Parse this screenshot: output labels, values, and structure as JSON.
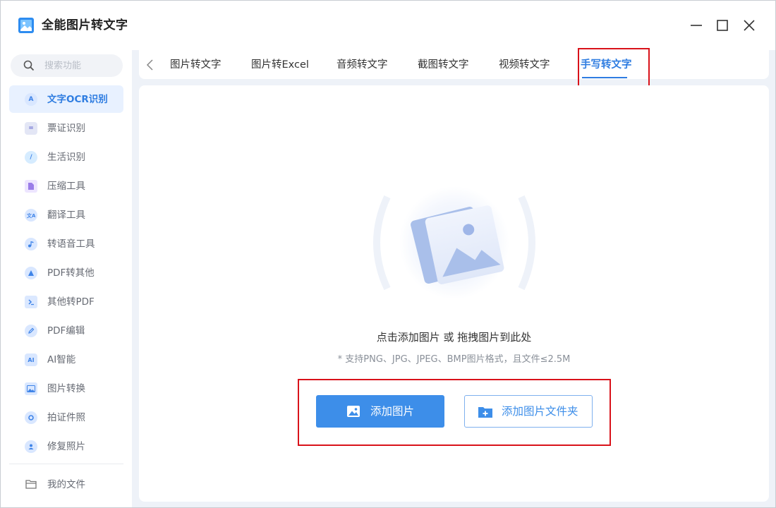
{
  "app": {
    "title": "全能图片转文字",
    "colors": {
      "accent": "#3d8ee9",
      "active_text": "#2f7de1",
      "highlight": "#d9121a"
    }
  },
  "window_controls": {
    "minimize_icon": "minimize-icon",
    "maximize_icon": "maximize-icon",
    "close_icon": "close-icon"
  },
  "sidebar": {
    "search_placeholder": "搜索功能",
    "items": [
      {
        "label": "文字OCR识别",
        "icon": "A",
        "active": true
      },
      {
        "label": "票证识别",
        "icon": "="
      },
      {
        "label": "生活识别",
        "icon": "/"
      },
      {
        "label": "压缩工具",
        "icon": ""
      },
      {
        "label": "翻译工具",
        "icon": ""
      },
      {
        "label": "转语音工具",
        "icon": ""
      },
      {
        "label": "PDF转其他",
        "icon": ""
      },
      {
        "label": "其他转PDF",
        "icon": ""
      },
      {
        "label": "PDF编辑",
        "icon": ""
      },
      {
        "label": "AI智能",
        "icon": "AI"
      },
      {
        "label": "图片转换",
        "icon": ""
      },
      {
        "label": "拍证件照",
        "icon": ""
      },
      {
        "label": "修复照片",
        "icon": ""
      }
    ],
    "my_files": "我的文件"
  },
  "tabs": {
    "items": [
      {
        "label": "图片转文字"
      },
      {
        "label": "图片转Excel"
      },
      {
        "label": "音频转文字"
      },
      {
        "label": "截图转文字"
      },
      {
        "label": "视频转文字"
      },
      {
        "label": "手写转文字",
        "active": true
      }
    ]
  },
  "upload": {
    "title": "点击添加图片 或 拖拽图片到此处",
    "hint": "* 支持PNG、JPG、JPEG、BMP图片格式，且文件≤2.5M",
    "add_image_label": "添加图片",
    "add_folder_label": "添加图片文件夹"
  }
}
